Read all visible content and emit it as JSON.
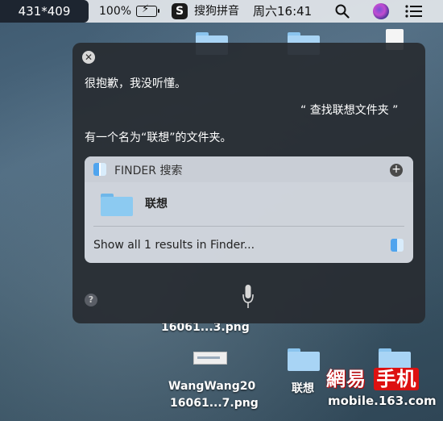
{
  "menubar": {
    "dimensions_badge": "431*409",
    "battery_percent": "100%",
    "input_method_badge": "S",
    "input_method": "搜狗拼音",
    "clock": "周六16:41"
  },
  "desktop": {
    "labels": {
      "file_a": "16061...3.png",
      "file_b_line1": "WangWang20",
      "file_b_line2": "16061...7.png",
      "folder": "联想"
    }
  },
  "siri": {
    "close_glyph": "✕",
    "apology": "很抱歉，我没听懂。",
    "user_query": "“ 查找联想文件夹 ”",
    "response": "有一个名为“联想”的文件夹。",
    "result_card": {
      "title": "FINDER 搜索",
      "add_glyph": "+",
      "item_label": "联想",
      "show_all": "Show all 1 results in Finder..."
    },
    "help_glyph": "?"
  },
  "watermark": {
    "brand_a": "網易",
    "brand_b": "手机",
    "url": "mobile.163.com"
  },
  "colors": {
    "menubar_bg": "#e4e7ec",
    "siri_panel_bg": "#282c32",
    "folder_blue": "#a8d4f5",
    "watermark_red": "#dd1111"
  }
}
